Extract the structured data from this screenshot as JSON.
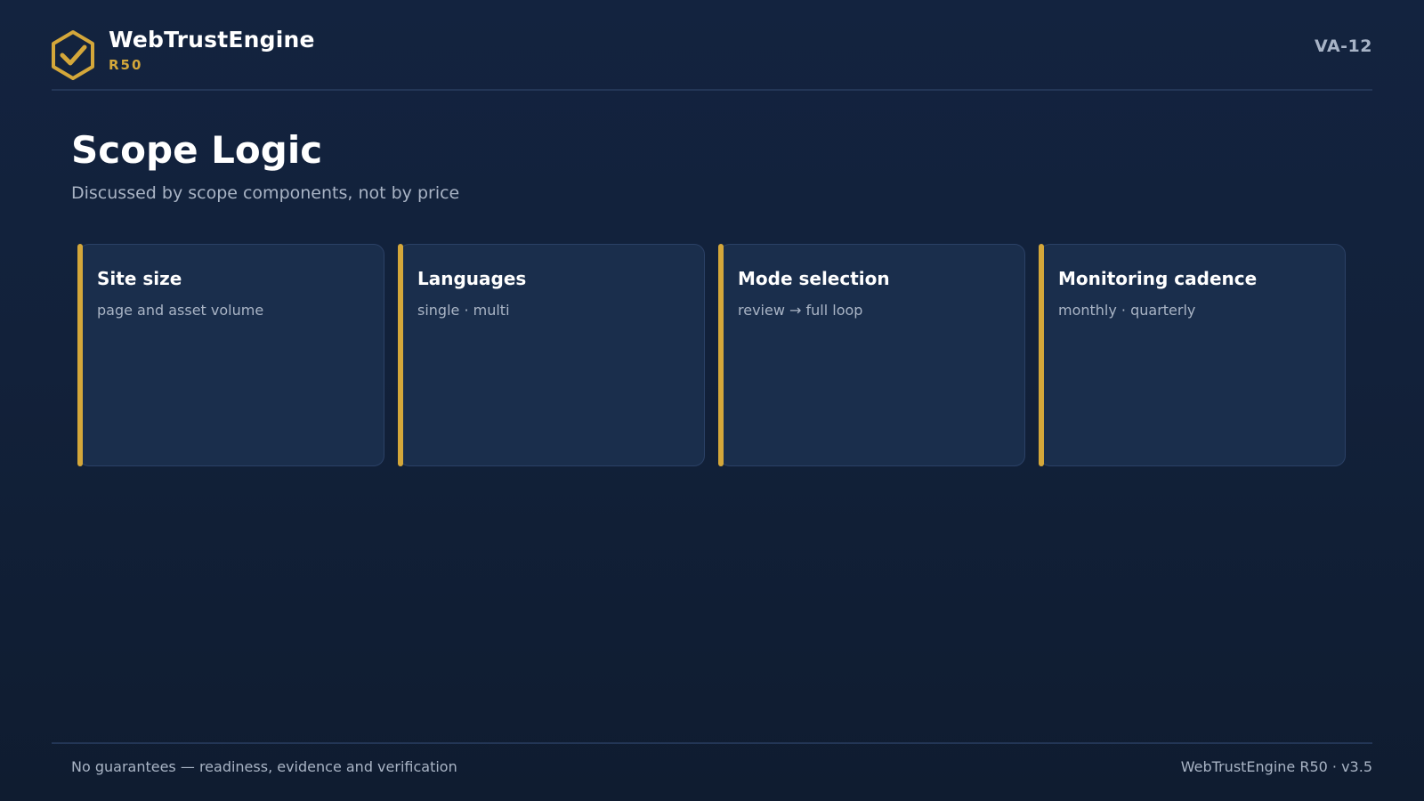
{
  "brand": {
    "name": "WebTrustEngine",
    "subtitle": "R50",
    "logo_icon": "hexagon-check-icon",
    "accent_color": "#d4a73a"
  },
  "header": {
    "doc_code": "VA-12"
  },
  "page": {
    "title": "Scope Logic",
    "subtitle": "Discussed by scope components, not by price"
  },
  "cards": [
    {
      "title": "Site size",
      "description": "page and asset volume"
    },
    {
      "title": "Languages",
      "description": "single · multi"
    },
    {
      "title": "Mode selection",
      "description": "review → full loop"
    },
    {
      "title": "Monitoring cadence",
      "description": "monthly · quarterly"
    }
  ],
  "footer": {
    "left_text": "No guarantees — readiness, evidence and verification",
    "right_text": "WebTrustEngine R50 · v3.5"
  }
}
